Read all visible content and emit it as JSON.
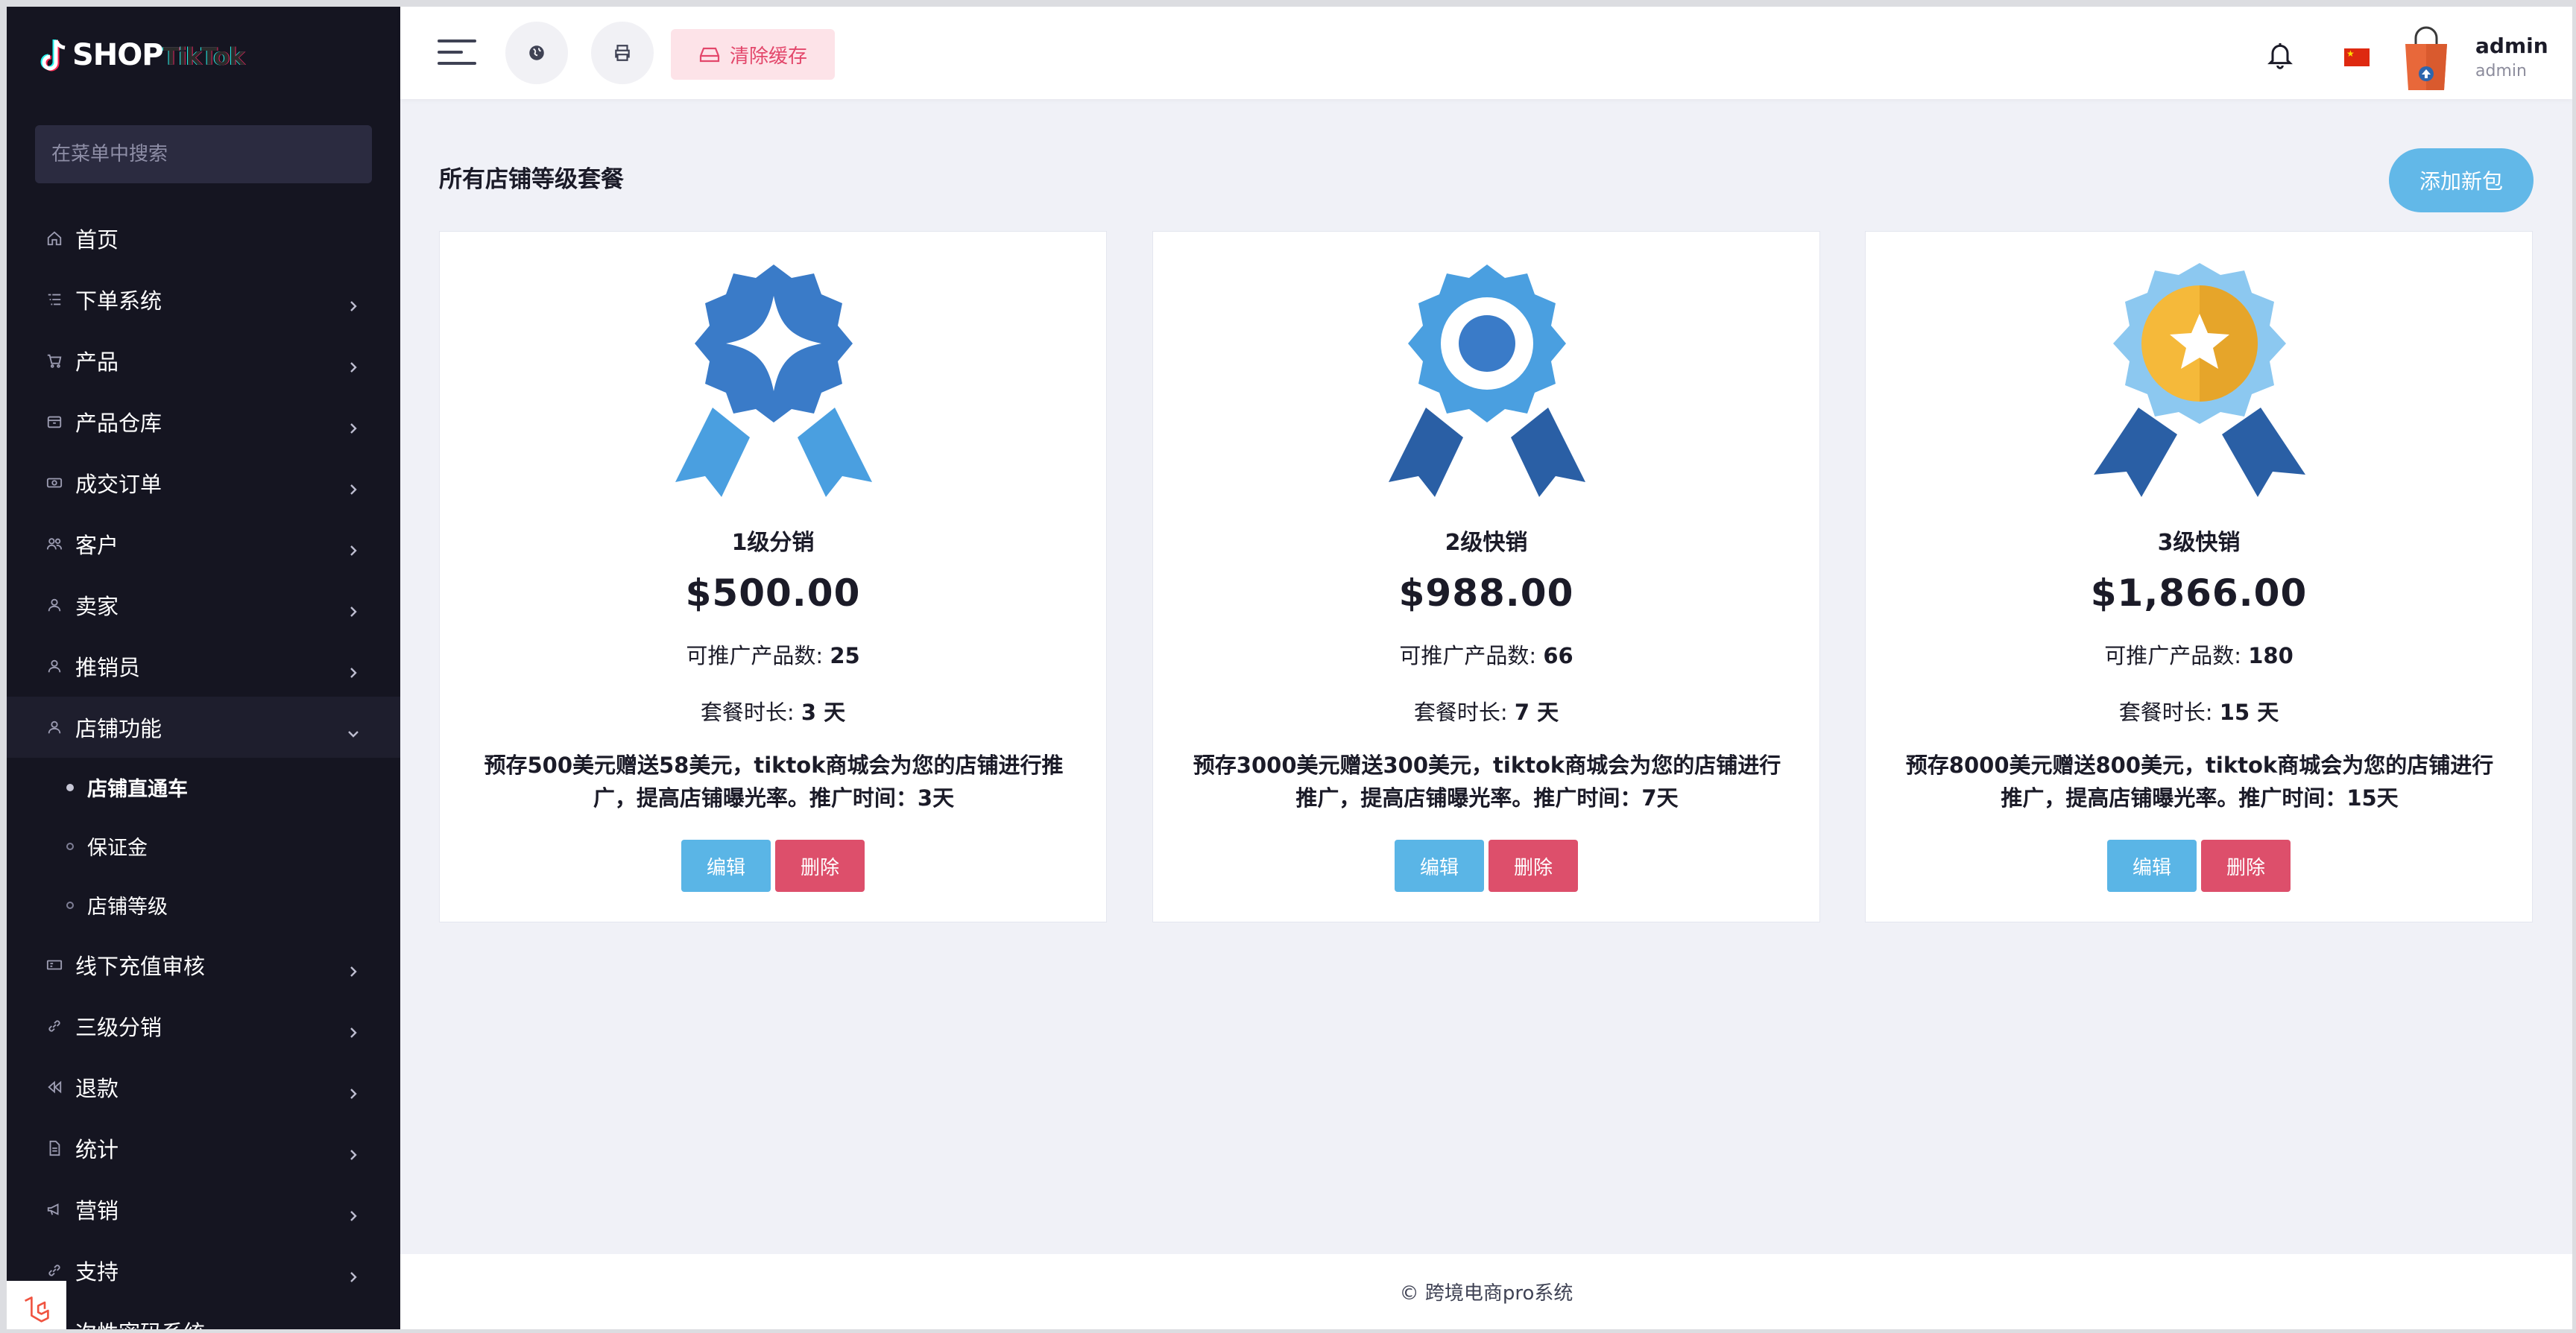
{
  "brand": {
    "logo_main": "SHOP",
    "logo_sub": "TikTok"
  },
  "sidebar": {
    "search_placeholder": "在菜单中搜索",
    "items": [
      {
        "label": "首页",
        "icon": "home-icon",
        "has_children": false
      },
      {
        "label": "下单系统",
        "icon": "list-icon",
        "has_children": true
      },
      {
        "label": "产品",
        "icon": "cart-icon",
        "has_children": true
      },
      {
        "label": "产品仓库",
        "icon": "warehouse-icon",
        "has_children": true
      },
      {
        "label": "成交订单",
        "icon": "money-icon",
        "has_children": true
      },
      {
        "label": "客户",
        "icon": "users-icon",
        "has_children": true
      },
      {
        "label": "卖家",
        "icon": "user-icon",
        "has_children": true
      },
      {
        "label": "推销员",
        "icon": "user-icon",
        "has_children": true
      },
      {
        "label": "店铺功能",
        "icon": "user-icon",
        "has_children": true,
        "expanded": true,
        "children": [
          {
            "label": "店铺直通车",
            "active": true
          },
          {
            "label": "保证金",
            "active": false
          },
          {
            "label": "店铺等级",
            "active": false
          }
        ]
      },
      {
        "label": "线下充值审核",
        "icon": "cash-icon",
        "has_children": true
      },
      {
        "label": "三级分销",
        "icon": "link-icon",
        "has_children": true
      },
      {
        "label": "退款",
        "icon": "rewind-icon",
        "has_children": true
      },
      {
        "label": "统计",
        "icon": "file-icon",
        "has_children": true
      },
      {
        "label": "营销",
        "icon": "megaphone-icon",
        "has_children": true
      },
      {
        "label": "支持",
        "icon": "link-icon",
        "has_children": true
      },
      {
        "label": "次性密码系统",
        "icon": "lock-icon",
        "has_children": true
      }
    ]
  },
  "header": {
    "clear_cache_label": "清除缓存",
    "user_name": "admin",
    "user_role": "admin",
    "language_flag": "China"
  },
  "main": {
    "title": "所有店铺等级套餐",
    "add_button_label": "添加新包",
    "packages": [
      {
        "name": "1级分销",
        "price": "$500.00",
        "products_label": "可推广产品数: ",
        "products_value": "25",
        "duration_label": "套餐时长: ",
        "duration_value": "3 天",
        "description": "预存500美元赠送58美元，tiktok商城会为您的店铺进行推广，提高店铺曝光率。推广时间：3天",
        "edit_label": "编辑",
        "delete_label": "删除",
        "medal": "badge-icon"
      },
      {
        "name": "2级快销",
        "price": "$988.00",
        "products_label": "可推广产品数: ",
        "products_value": "66",
        "duration_label": "套餐时长: ",
        "duration_value": "7 天",
        "description": "预存3000美元赠送300美元，tiktok商城会为您的店铺进行推广，提高店铺曝光率。推广时间：7天",
        "edit_label": "编辑",
        "delete_label": "删除",
        "medal": "award-icon"
      },
      {
        "name": "3级快销",
        "price": "$1,866.00",
        "products_label": "可推广产品数: ",
        "products_value": "180",
        "duration_label": "套餐时长: ",
        "duration_value": "15 天",
        "description": "预存8000美元赠送800美元，tiktok商城会为您的店铺进行推广，提高店铺曝光率。推广时间：15天",
        "edit_label": "编辑",
        "delete_label": "删除",
        "medal": "star-medal-icon"
      }
    ]
  },
  "footer": {
    "text": "© 跨境电商pro系统"
  },
  "colors": {
    "sidebar_bg": "#151521",
    "accent_blue": "#5ab5e6",
    "danger": "#dd4f6b",
    "clear_cache_bg": "#fde3e8",
    "clear_cache_text": "#e3476b"
  }
}
